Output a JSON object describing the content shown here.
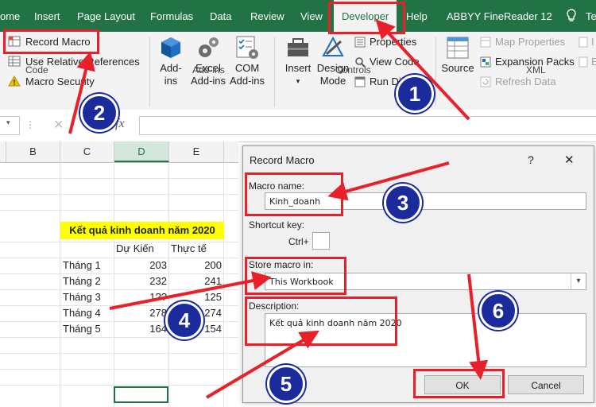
{
  "ribbon_tabs": [
    "ome",
    "Insert",
    "Page Layout",
    "Formulas",
    "Data",
    "Review",
    "View",
    "Developer",
    "Help",
    "ABBYY FineReader 12",
    "Te"
  ],
  "code_group": {
    "record_macro": "Record Macro",
    "use_relative": "Use Relative References",
    "macro_security": "Macro Security",
    "label": "Code"
  },
  "addins_group": {
    "addins_line1": "Add-",
    "addins_line2": "ins",
    "excel_line1": "Excel",
    "excel_line2": "Add-ins",
    "com_line1": "COM",
    "com_line2": "Add-ins",
    "label": "Add-ins"
  },
  "controls_group": {
    "insert": "Insert",
    "design_line1": "Design",
    "design_line2": "Mode",
    "properties": "Properties",
    "view_code": "View Code",
    "run_dialog": "Run Dialog",
    "label": "Controls"
  },
  "xml_group": {
    "source": "Source",
    "map_properties": "Map Properties",
    "expansion_packs": "Expansion Packs",
    "refresh_data": "Refresh Data",
    "label": "XML",
    "import": "I",
    "export": "E"
  },
  "formula_bar": {
    "fx": "fx",
    "cancel": "✕"
  },
  "sheet": {
    "columns": [
      "B",
      "C",
      "D",
      "E"
    ],
    "title": "Kết quả kinh doanh năm 2020",
    "header_du_kien": "Dự Kiến",
    "header_thuc_te": "Thực tế",
    "rows": [
      {
        "label": "Tháng 1",
        "du_kien": "203",
        "thuc_te": "200"
      },
      {
        "label": "Tháng 2",
        "du_kien": "232",
        "thuc_te": "241"
      },
      {
        "label": "Tháng 3",
        "du_kien": "1??",
        "thuc_te": "125"
      },
      {
        "label": "Tháng 4",
        "du_kien": "278",
        "thuc_te": "274"
      },
      {
        "label": "Tháng 5",
        "du_kien": "164",
        "thuc_te": "154"
      }
    ]
  },
  "dialog": {
    "title": "Record Macro",
    "help": "?",
    "close": "✕",
    "macro_name_label": "Macro name:",
    "macro_name_value": "Kinh_doanh",
    "shortcut_label": "Shortcut key:",
    "ctrl_label": "Ctrl+",
    "shortcut_value": "",
    "store_label": "Store macro in:",
    "store_value": "This Workbook",
    "description_label": "Description:",
    "description_value": "Kết quả kinh doanh năm 2020",
    "ok": "OK",
    "cancel": "Cancel"
  },
  "annotations": [
    "1",
    "2",
    "3",
    "4",
    "5",
    "6"
  ],
  "colors": {
    "ribbon_green": "#217346",
    "annotation_red": "#e8202a",
    "badge_blue": "#1b2b9c",
    "title_fill": "#ffff00"
  }
}
